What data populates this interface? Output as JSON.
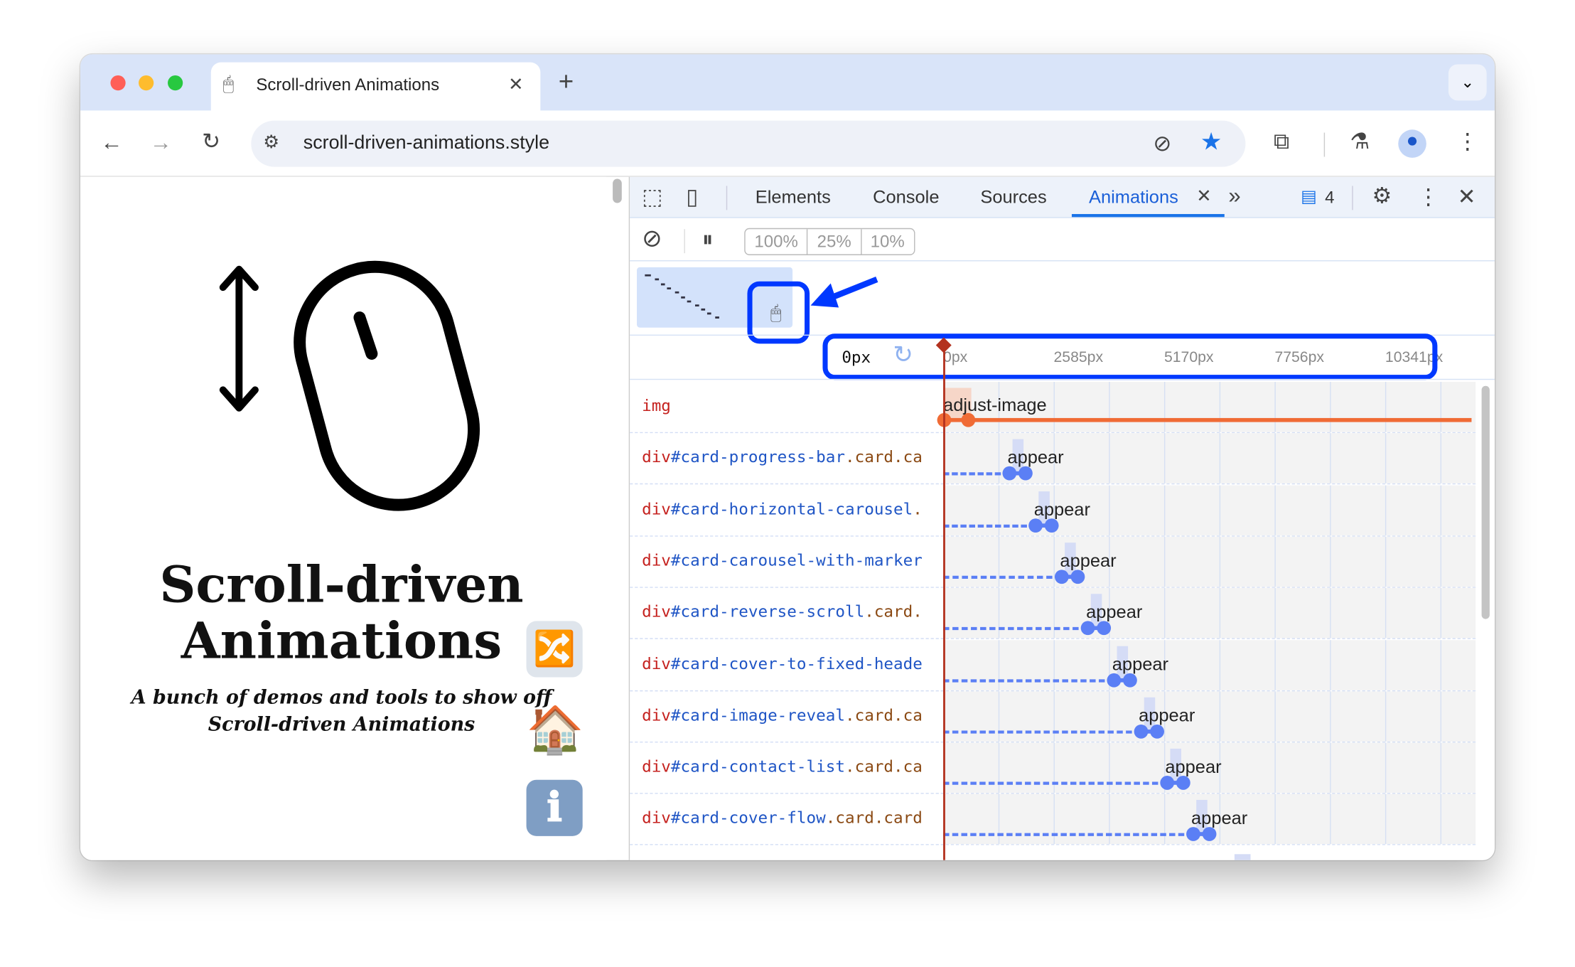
{
  "browser": {
    "tab_title": "Scroll-driven Animations",
    "new_tab": "+",
    "url": "scroll-driven-animations.style",
    "star_color": "#1a73e8",
    "icons": [
      "back-icon",
      "forward-icon",
      "reload-icon",
      "site-settings-icon",
      "eye-off-icon",
      "star-icon",
      "extensions-icon",
      "labs-flask-icon",
      "profile-icon",
      "menu-icon"
    ]
  },
  "page": {
    "title_line1": "Scroll-driven",
    "title_line2": "Animations",
    "subtitle_line1": "A bunch of demos and tools to show off",
    "subtitle_line2": "Scroll-driven Animations",
    "buttons": {
      "shuffle": "🔀",
      "home": "🏠",
      "info": "ℹ"
    }
  },
  "devtools": {
    "tabs": [
      "Elements",
      "Console",
      "Sources",
      "Animations"
    ],
    "active_tab": "Animations",
    "more_tabs": "»",
    "issues_count": "4",
    "speeds": [
      "100%",
      "25%",
      "10%"
    ],
    "current_time": "0px",
    "ticks": [
      "0px",
      "2585px",
      "5170px",
      "7756px",
      "10341px"
    ],
    "accent": "#1a73e8",
    "animations": [
      {
        "tag": "img",
        "id": "",
        "cls": "",
        "name": "adjust-image",
        "infinite_to_end": true,
        "color": "#f06b35"
      },
      {
        "tag": "div",
        "id": "#card-progress-bar",
        "cls": ".card.ca",
        "name": "appear",
        "color": "#5b7ff5"
      },
      {
        "tag": "div",
        "id": "#card-horizontal-carousel",
        "cls": ".",
        "name": "appear",
        "color": "#5b7ff5"
      },
      {
        "tag": "div",
        "id": "#card-carousel-with-marker",
        "cls": "",
        "name": "appear",
        "color": "#5b7ff5"
      },
      {
        "tag": "div",
        "id": "#card-reverse-scroll",
        "cls": ".card.",
        "name": "appear",
        "color": "#5b7ff5"
      },
      {
        "tag": "div",
        "id": "#card-cover-to-fixed-heade",
        "cls": "",
        "name": "appear",
        "color": "#5b7ff5"
      },
      {
        "tag": "div",
        "id": "#card-image-reveal",
        "cls": ".card.ca",
        "name": "appear",
        "color": "#5b7ff5"
      },
      {
        "tag": "div",
        "id": "#card-contact-list",
        "cls": ".card.ca",
        "name": "appear",
        "color": "#5b7ff5"
      },
      {
        "tag": "div",
        "id": "#card-cover-flow",
        "cls": ".card.card",
        "name": "appear",
        "color": "#5b7ff5"
      }
    ]
  }
}
